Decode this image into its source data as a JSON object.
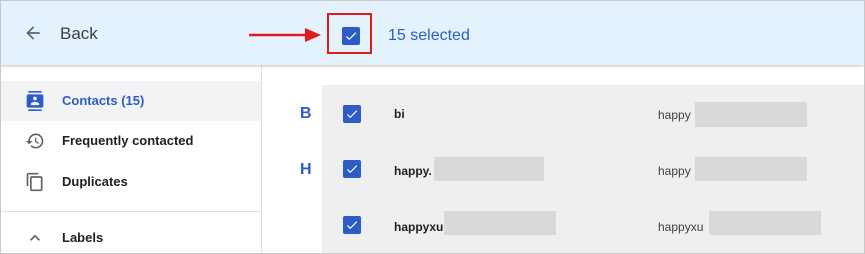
{
  "header": {
    "back_label": "Back",
    "selected_count": "15 selected"
  },
  "colors": {
    "header_bg": "#e3f2fd",
    "accent": "#2e5cc7",
    "highlight": "#e01b1b"
  },
  "sidebar": {
    "items": [
      {
        "label": "Contacts (15)",
        "icon": "contacts-icon",
        "active": true
      },
      {
        "label": "Frequently contacted",
        "icon": "history-icon",
        "active": false
      },
      {
        "label": "Duplicates",
        "icon": "duplicates-icon",
        "active": false
      }
    ],
    "labels_section": {
      "label": "Labels",
      "icon": "chevron-up-icon"
    }
  },
  "contacts": {
    "rows": [
      {
        "letter": "B",
        "name": "bi",
        "email": "happy",
        "checked": true
      },
      {
        "letter": "H",
        "name": "happy.",
        "email": "happy",
        "checked": true
      },
      {
        "letter": "",
        "name": "happyxu",
        "email": "happyxu",
        "checked": true
      }
    ]
  }
}
